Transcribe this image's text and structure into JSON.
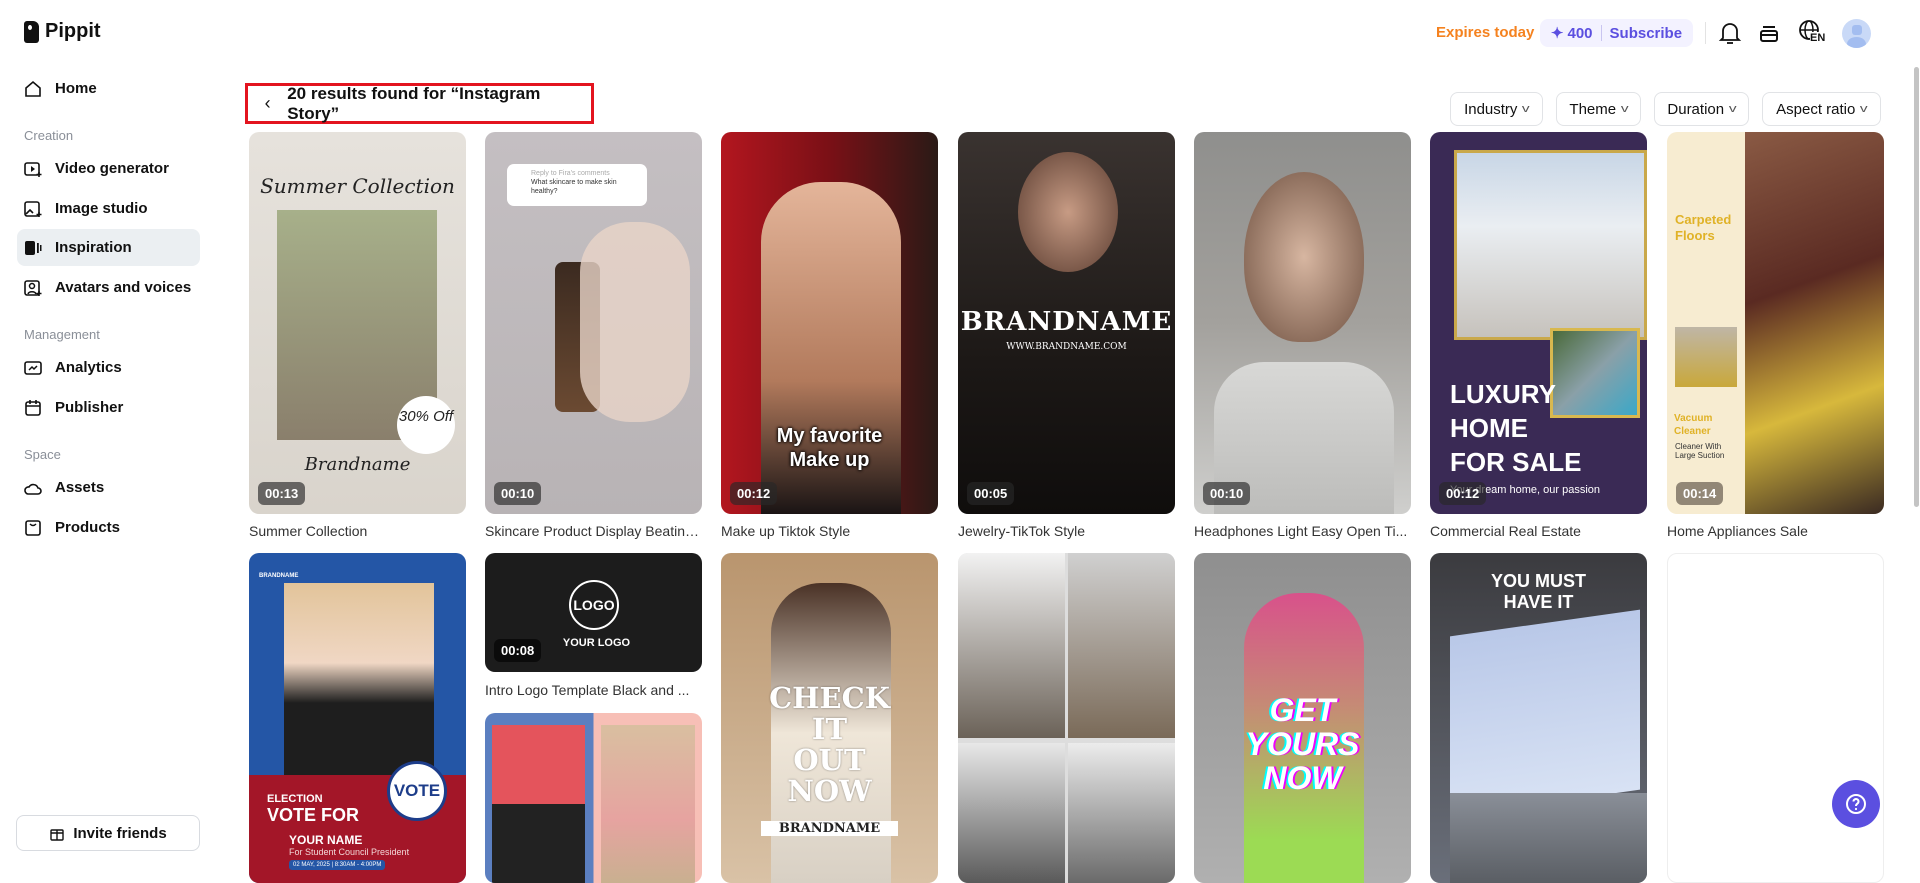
{
  "app": {
    "name": "Pippit"
  },
  "sidebar": {
    "home": "Home",
    "sections": {
      "creation": "Creation",
      "management": "Management",
      "space": "Space"
    },
    "items": [
      {
        "label": "Video generator",
        "icon": "video-plus-icon"
      },
      {
        "label": "Image studio",
        "icon": "image-plus-icon"
      },
      {
        "label": "Inspiration",
        "icon": "inspiration-icon"
      },
      {
        "label": "Avatars and voices",
        "icon": "avatar-plus-icon"
      },
      {
        "label": "Analytics",
        "icon": "analytics-icon"
      },
      {
        "label": "Publisher",
        "icon": "calendar-icon"
      },
      {
        "label": "Assets",
        "icon": "cloud-icon"
      },
      {
        "label": "Products",
        "icon": "box-icon"
      }
    ],
    "invite": "Invite friends"
  },
  "header": {
    "expires": "Expires today",
    "credits": "400",
    "subscribe": "Subscribe",
    "lang": "EN"
  },
  "search": {
    "results": "20 results found for “Instagram Story”"
  },
  "filters": [
    "Industry",
    "Theme",
    "Duration",
    "Aspect ratio"
  ],
  "colors": {
    "accent": "#5b4fe0",
    "expires": "#f5821f",
    "highlight": "#e3141f"
  },
  "cards": [
    {
      "title": "Summer Collection",
      "duration": "00:13",
      "overlay": [
        "Summer Collection",
        "30% Off",
        "Brandname"
      ]
    },
    {
      "title": "Skincare Product Display Beating...",
      "duration": "00:10",
      "overlay": [
        "Reply to Fira's comments",
        "What skincare to make skin healthy?"
      ]
    },
    {
      "title": "Make up Tiktok Style",
      "duration": "00:12",
      "overlay": [
        "My favorite",
        "Make up"
      ]
    },
    {
      "title": "Jewelry-TikTok Style",
      "duration": "00:05",
      "overlay": [
        "BRANDNAME",
        "WWW.BRANDNAME.COM"
      ]
    },
    {
      "title": "Headphones Light Easy Open Ti...",
      "duration": "00:10",
      "overlay": []
    },
    {
      "title": "Commercial Real Estate",
      "duration": "00:12",
      "overlay": [
        "LUXURY",
        "HOME",
        "FOR SALE",
        "Your dream home, our passion"
      ]
    },
    {
      "title": "Home Appliances Sale",
      "duration": "00:14",
      "overlay": [
        "Carpeted Floors",
        "Vacuum Cleaner",
        "Cleaner With Large Suction"
      ]
    },
    {
      "title": "",
      "duration": "",
      "overlay": [
        "BRANDNAME",
        "ELECTION",
        "VOTE FOR",
        "YOUR NAME",
        "For Student Council President",
        "02 MAY, 2025  |  8:30AM - 4:00PM",
        "VOTE"
      ]
    },
    {
      "title": "Intro Logo Template Black and ...",
      "duration": "00:08",
      "overlay": [
        "LOGO",
        "YOUR LOGO"
      ]
    },
    {
      "title": "",
      "duration": "",
      "overlay": [
        "CHECK",
        "IT",
        "OUT",
        "NOW",
        "BRANDNAME"
      ]
    },
    {
      "title": "",
      "duration": "",
      "overlay": []
    },
    {
      "title": "",
      "duration": "",
      "overlay": [
        "GET",
        "YOURS",
        "NOW"
      ]
    },
    {
      "title": "",
      "duration": "",
      "overlay": [
        "YOU MUST",
        "HAVE IT"
      ]
    }
  ]
}
